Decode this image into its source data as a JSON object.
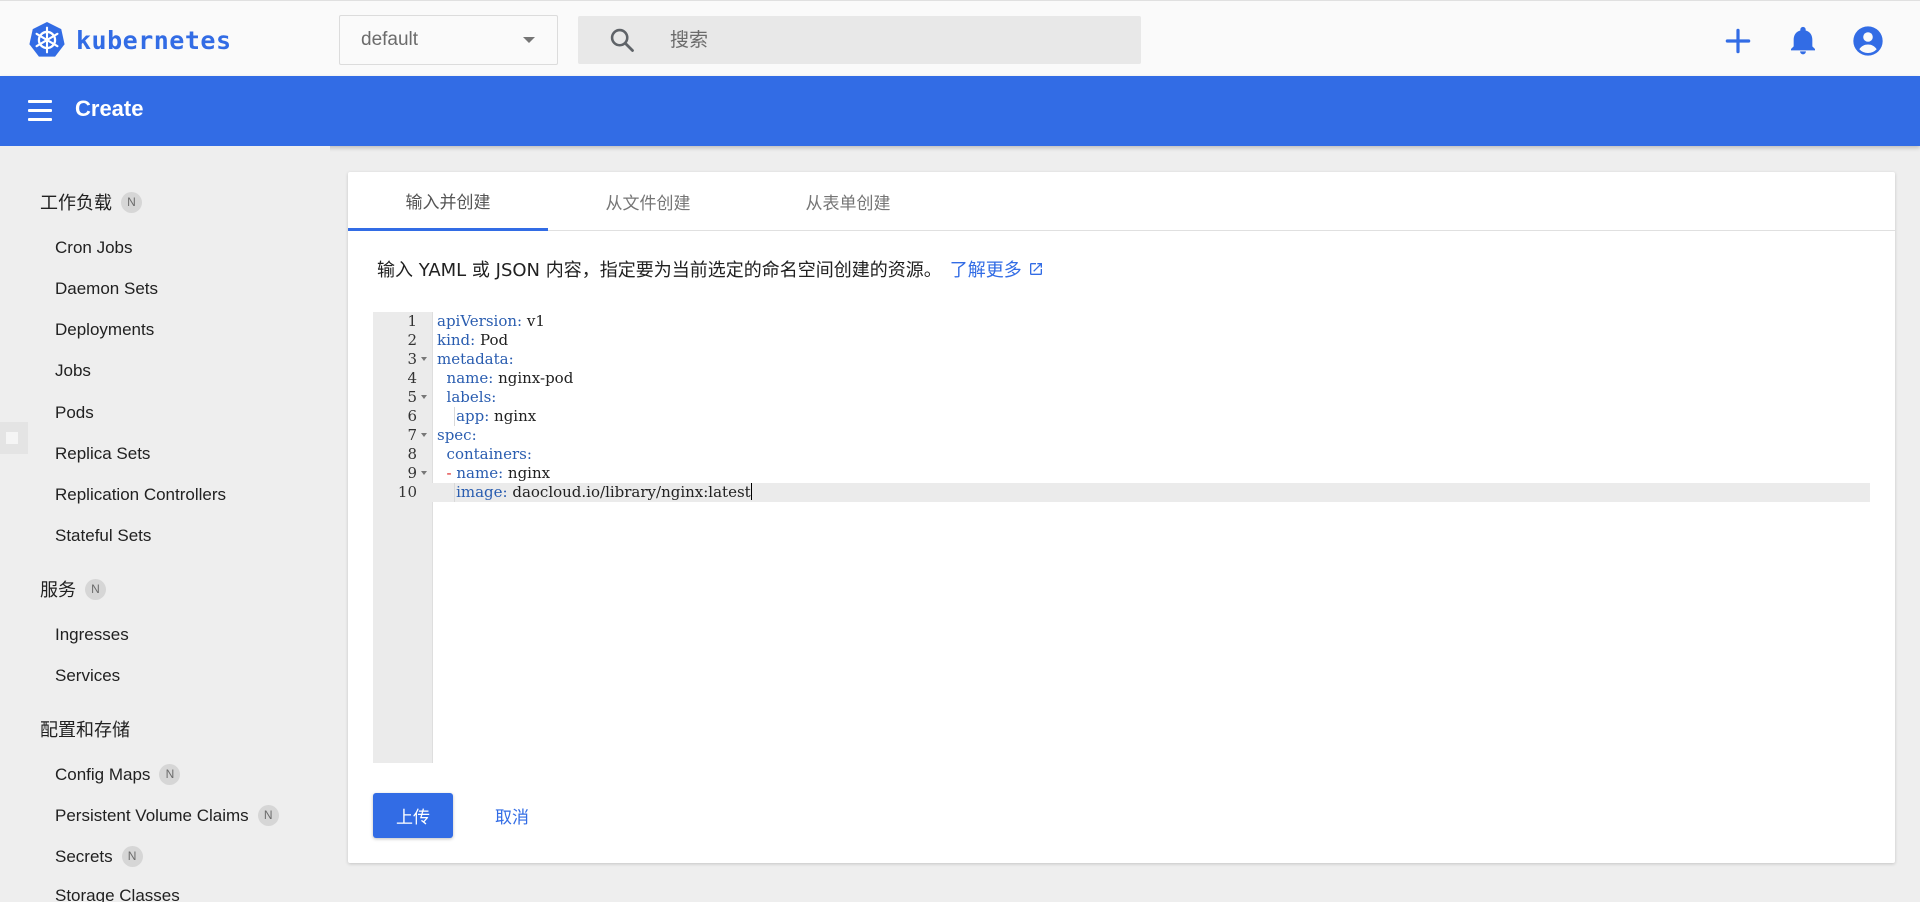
{
  "app": {
    "logo_text": "kubernetes",
    "brand_color": "#326ce5"
  },
  "topbar": {
    "namespace_selected": "default",
    "search_placeholder": "搜索",
    "icons": [
      "add-icon",
      "bell-icon",
      "account-circle-icon"
    ]
  },
  "header": {
    "title": "Create"
  },
  "sidebar": {
    "sections": [
      {
        "label": "工作负载",
        "badge": "N",
        "items": [
          {
            "label": "Cron Jobs"
          },
          {
            "label": "Daemon Sets"
          },
          {
            "label": "Deployments"
          },
          {
            "label": "Jobs"
          },
          {
            "label": "Pods"
          },
          {
            "label": "Replica Sets"
          },
          {
            "label": "Replication Controllers"
          },
          {
            "label": "Stateful Sets"
          }
        ]
      },
      {
        "label": "服务",
        "badge": "N",
        "items": [
          {
            "label": "Ingresses"
          },
          {
            "label": "Services"
          }
        ]
      },
      {
        "label": "配置和存储",
        "items": [
          {
            "label": "Config Maps",
            "badge": "N"
          },
          {
            "label": "Persistent Volume Claims",
            "badge": "N"
          },
          {
            "label": "Secrets",
            "badge": "N"
          },
          {
            "label": "Storage Classes"
          }
        ]
      }
    ]
  },
  "main": {
    "tabs": [
      {
        "label": "输入并创建",
        "active": true
      },
      {
        "label": "从文件创建",
        "active": false
      },
      {
        "label": "从表单创建",
        "active": false
      }
    ],
    "description": "输入 YAML 或 JSON 内容，指定要为当前选定的命名空间创建的资源。",
    "learn_more": "了解更多",
    "editor": {
      "active_line": 10,
      "lines": [
        {
          "n": "1",
          "indent": "",
          "key": "apiVersion:",
          "value": " v1",
          "fold": false
        },
        {
          "n": "2",
          "indent": "",
          "key": "kind:",
          "value": " Pod",
          "fold": false
        },
        {
          "n": "3",
          "indent": "",
          "key": "metadata:",
          "value": "",
          "fold": true
        },
        {
          "n": "4",
          "indent": "  ",
          "key": "name:",
          "value": " nginx-pod",
          "fold": false
        },
        {
          "n": "5",
          "indent": "  ",
          "key": "labels:",
          "value": "",
          "fold": true
        },
        {
          "n": "6",
          "indent": "    ",
          "key": "app:",
          "value": " nginx",
          "fold": false
        },
        {
          "n": "7",
          "indent": "",
          "key": "spec:",
          "value": "",
          "fold": true
        },
        {
          "n": "8",
          "indent": "  ",
          "key": "containers:",
          "value": "",
          "fold": false
        },
        {
          "n": "9",
          "indent": "  ",
          "dash": "- ",
          "key": "name:",
          "value": " nginx",
          "fold": true
        },
        {
          "n": "10",
          "indent": "    ",
          "key": "image:",
          "value": " daocloud.io/library/nginx:latest",
          "fold": false
        }
      ]
    },
    "upload_label": "上传",
    "cancel_label": "取消"
  }
}
